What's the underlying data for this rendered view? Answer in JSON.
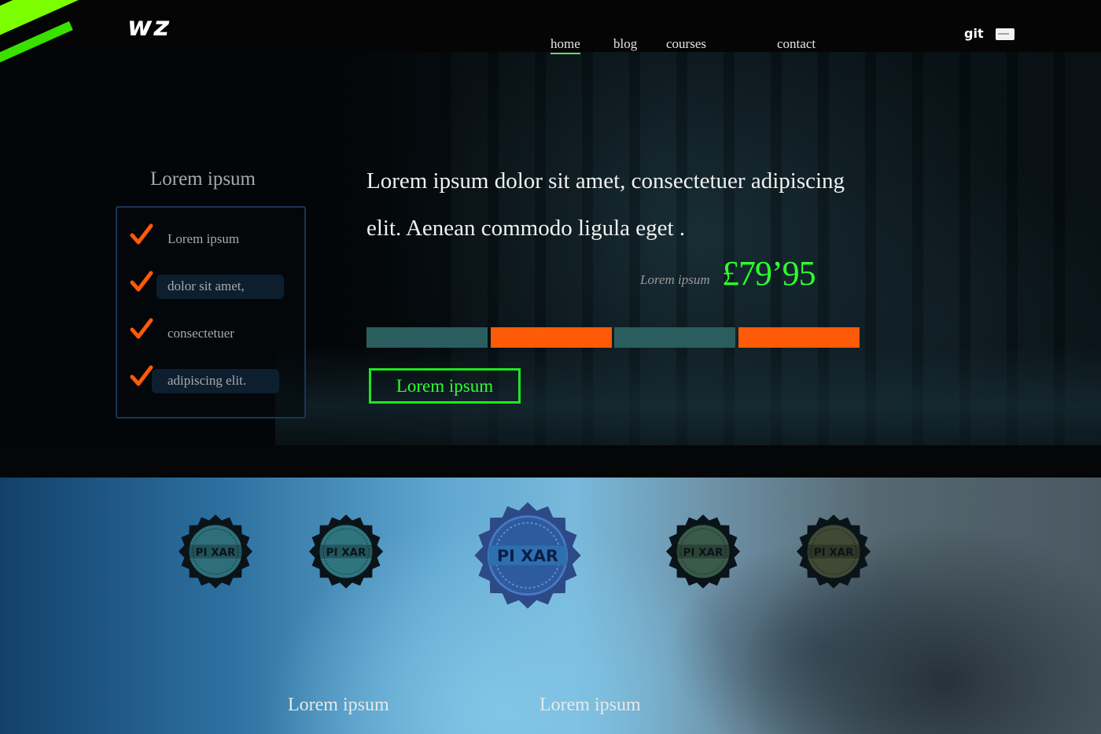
{
  "header": {
    "logo": "wz",
    "nav": [
      {
        "label": "home",
        "active": true
      },
      {
        "label": "blog",
        "active": false
      },
      {
        "label": "courses",
        "active": false
      },
      {
        "label": "contact",
        "active": false
      }
    ],
    "icons": [
      "git-icon",
      "credit-card-icon"
    ],
    "git_label": "git"
  },
  "features": {
    "title": "Lorem ipsum",
    "items": [
      {
        "label": "Lorem ipsum",
        "highlighted": false
      },
      {
        "label": "dolor sit amet,",
        "highlighted": true
      },
      {
        "label": "consectetuer",
        "highlighted": false
      },
      {
        "label": "adipiscing elit.",
        "highlighted": true
      }
    ]
  },
  "hero": {
    "headline": "Lorem ipsum dolor sit amet, consectetuer adipiscing elit. Aenean commodo ligula eget .",
    "price_label": "Lorem ipsum",
    "price": "£79’95",
    "bar_colors": [
      "#2a5e5e",
      "#ff5a08",
      "#2a5e5e",
      "#ff5a08"
    ],
    "cta_label": "Lorem ipsum"
  },
  "badges": {
    "text": "PI XAR",
    "items": [
      {
        "label": "PI XAR",
        "tint": "#2f6f7a"
      },
      {
        "label": "PI XAR",
        "tint": "#2f7580"
      },
      {
        "label": "PI XAR",
        "tint": "#2e5a9e"
      },
      {
        "label": "PI XAR",
        "tint": "#3a5a4a"
      },
      {
        "label": "PI XAR",
        "tint": "#3e4a34"
      }
    ],
    "labels": [
      "Lorem ipsum",
      "Lorem ipsum"
    ]
  },
  "colors": {
    "accent_green": "#2fff2f",
    "accent_orange": "#ff5a08",
    "slash_green": "#7cff00"
  }
}
